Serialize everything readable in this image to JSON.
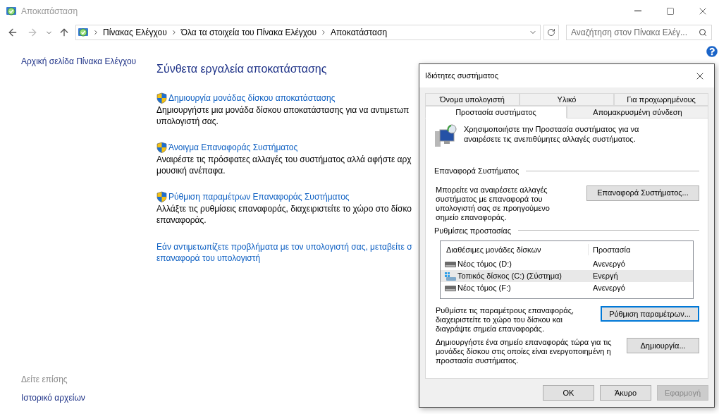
{
  "window": {
    "title": "Αποκατάσταση"
  },
  "address_bar": {
    "crumbs": [
      "Πίνακας Ελέγχου",
      "Όλα τα στοιχεία του Πίνακα Ελέγχου",
      "Αποκατάσταση"
    ]
  },
  "search": {
    "placeholder": "Αναζήτηση στον Πίνακα Ελέγ..."
  },
  "sidebar": {
    "home_link": "Αρχική σελίδα Πίνακα Ελέγχου",
    "see_also_heading": "Δείτε επίσης",
    "see_also_items": [
      "Ιστορικό αρχείων"
    ]
  },
  "main": {
    "heading": "Σύνθετα εργαλεία αποκατάστασης",
    "tools": [
      {
        "link": "Δημιουργία μονάδας δίσκου αποκατάστασης",
        "description": [
          "Δημιουργήστε μια μονάδα δίσκου αποκατάστασης για να αντιμετωπ",
          "υπολογιστή σας."
        ]
      },
      {
        "link": "Άνοιγμα Επαναφοράς Συστήματος",
        "description": [
          "Αναιρέστε τις πρόσφατες αλλαγές του συστήματος αλλά αφήστε αρχ",
          "μουσική ανέπαφα."
        ]
      },
      {
        "link": "Ρύθμιση παραμέτρων Επαναφοράς Συστήματος",
        "description": [
          "Αλλάξτε τις ρυθμίσεις επαναφοράς, διαχειριστείτε το χώρο στο δίσκο",
          "επαναφοράς."
        ]
      }
    ],
    "footer_link": [
      "Εάν αντιμετωπίζετε προβλήματα με τον υπολογιστή σας, μεταβείτε σ",
      "επαναφορά του υπολογιστή"
    ]
  },
  "dialog": {
    "title": "Ιδιότητες συστήματος",
    "tab_rows": [
      [
        {
          "label": "Όνομα υπολογιστή",
          "selected": false
        },
        {
          "label": "Υλικό",
          "selected": false
        },
        {
          "label": "Για προχωρημένους",
          "selected": false
        }
      ],
      [
        {
          "label": "Προστασία συστήματος",
          "selected": true
        },
        {
          "label": "Απομακρυσμένη σύνδεση",
          "selected": false
        }
      ]
    ],
    "intro": "Χρησιμοποιήστε την Προστασία συστήματος για να αναιρέσετε τις ανεπιθύμητες αλλαγές συστήματος.",
    "restore_group": {
      "label": "Επαναφορά Συστήματος",
      "text": "Μπορείτε να αναιρέσετε αλλαγές συστήματος με επαναφορά του υπολογιστή σας σε προηγούμενο σημείο επαναφοράς.",
      "button": "Επαναφορά Συστήματος..."
    },
    "protection_group": {
      "label": "Ρυθμίσεις προστασίας",
      "table": {
        "columns": [
          "Διαθέσιμες μονάδες δίσκων",
          "Προστασία"
        ],
        "rows": [
          {
            "kind": "drive",
            "drive": "Νέος τόμος (D:)",
            "protection": "Ανενεργό",
            "selected": false
          },
          {
            "kind": "system",
            "drive": "Τοπικός δίσκος (C:) (Σύστημα)",
            "protection": "Ενεργή",
            "selected": true
          },
          {
            "kind": "drive",
            "drive": "Νέος τόμος (F:)",
            "protection": "Ανενεργό",
            "selected": false
          }
        ]
      },
      "actions": [
        {
          "text": "Ρυθμίστε τις παραμέτρους επαναφοράς, διαχειριστείτε το χώρο του δίσκου και διαγράψτε σημεία επαναφοράς.",
          "button": "Ρύθμιση παραμέτρων...",
          "focused": true
        },
        {
          "text": "Δημιουργήστε ένα σημείο επαναφοράς τώρα για τις μονάδες δίσκου στις οποίες είναι ενεργοποιημένη η προστασία συστήματος.",
          "button": "Δημιουργία...",
          "focused": false
        }
      ]
    },
    "buttons": [
      {
        "label": "OK",
        "disabled": false
      },
      {
        "label": "Άκυρο",
        "disabled": false
      },
      {
        "label": "Εφαρμογή",
        "disabled": true
      }
    ]
  }
}
